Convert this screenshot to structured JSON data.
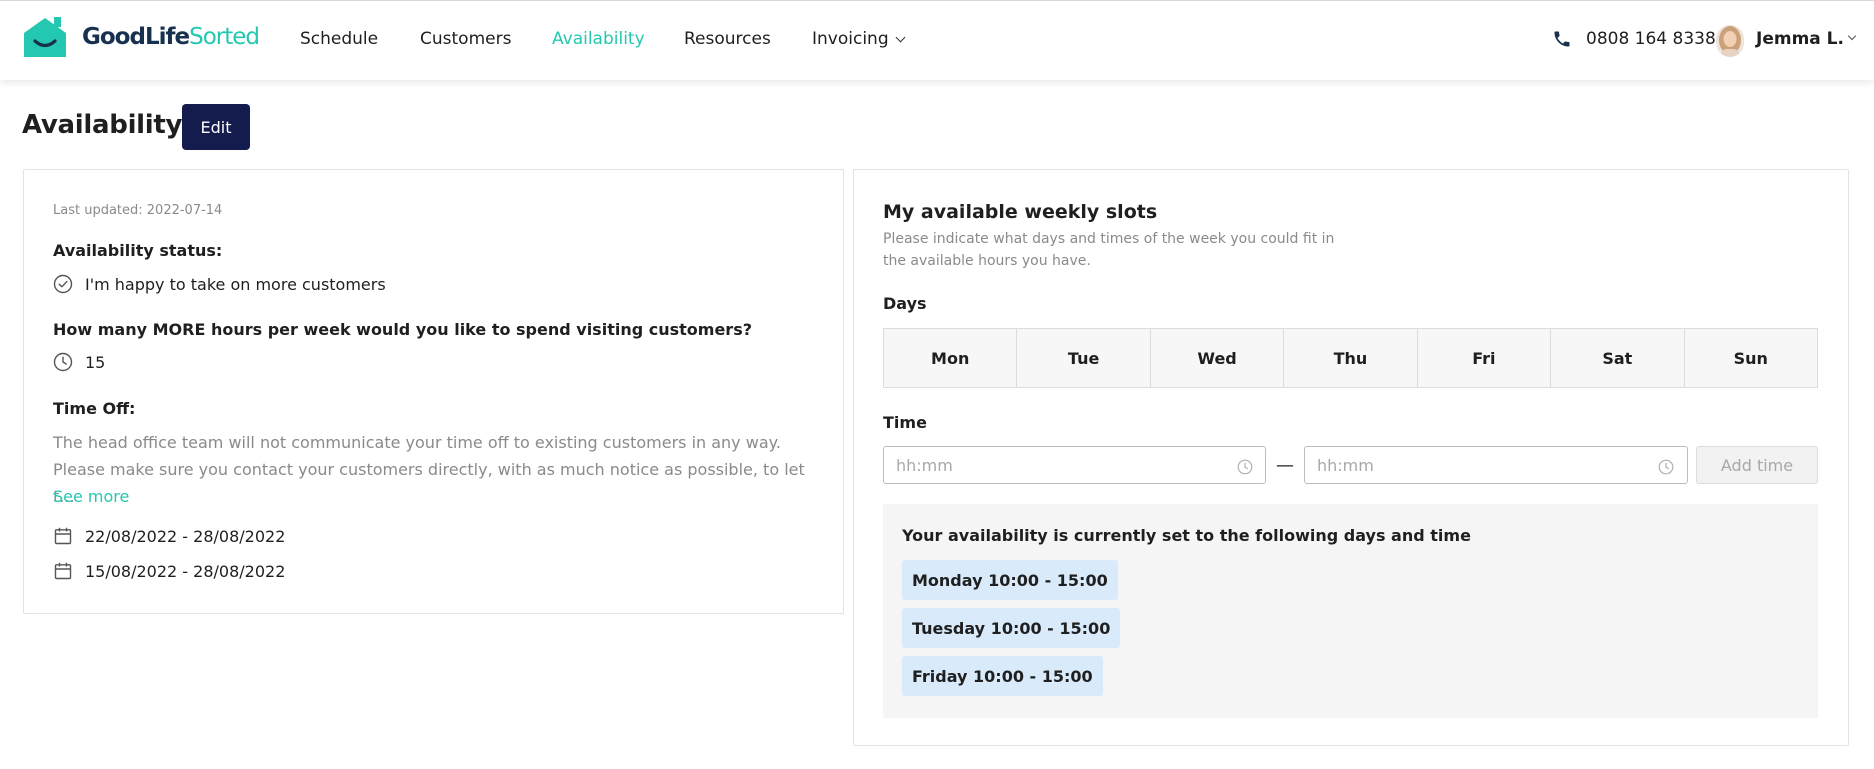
{
  "app": {
    "brand": {
      "part1": "Good",
      "part2": "Life",
      "part3": "Sorted"
    },
    "brand_color": "#24c8b0",
    "nav": {
      "schedule": "Schedule",
      "customers": "Customers",
      "availability": "Availability",
      "resources": "Resources",
      "invoicing": "Invoicing"
    },
    "phone": "0808 164 8338",
    "user_name": "Jemma L."
  },
  "page": {
    "title": "Availability",
    "edit_label": "Edit"
  },
  "status_panel": {
    "last_updated": "Last updated: 2022-07-14",
    "status_label": "Availability status:",
    "status_value": "I'm happy to take on more customers",
    "hours_question": "How many MORE hours per week would you like to spend visiting customers?",
    "hours_value": "15",
    "time_off_label": "Time Off:",
    "time_off_note": "The head office team will not communicate your time off to existing customers in any way. Please make sure you contact your customers directly, with as much notice as possible, to let t...",
    "see_more": "See more",
    "time_off_periods": [
      "22/08/2022 - 28/08/2022",
      "15/08/2022 - 28/08/2022"
    ]
  },
  "weekly_slots": {
    "title": "My available weekly slots",
    "subtitle": "Please indicate what days and times of the week you could fit in the available hours you have.",
    "days_label": "Days",
    "days": [
      "Mon",
      "Tue",
      "Wed",
      "Thu",
      "Fri",
      "Sat",
      "Sun"
    ],
    "time_label": "Time",
    "start_placeholder": "hh:mm",
    "end_placeholder": "hh:mm",
    "separator": "—",
    "add_time_label": "Add time",
    "summary_title": "Your availability is currently set to the following days and time",
    "current_slots": [
      "Monday 10:00 - 15:00",
      "Tuesday 10:00 - 15:00",
      "Friday 10:00 - 15:00"
    ]
  }
}
